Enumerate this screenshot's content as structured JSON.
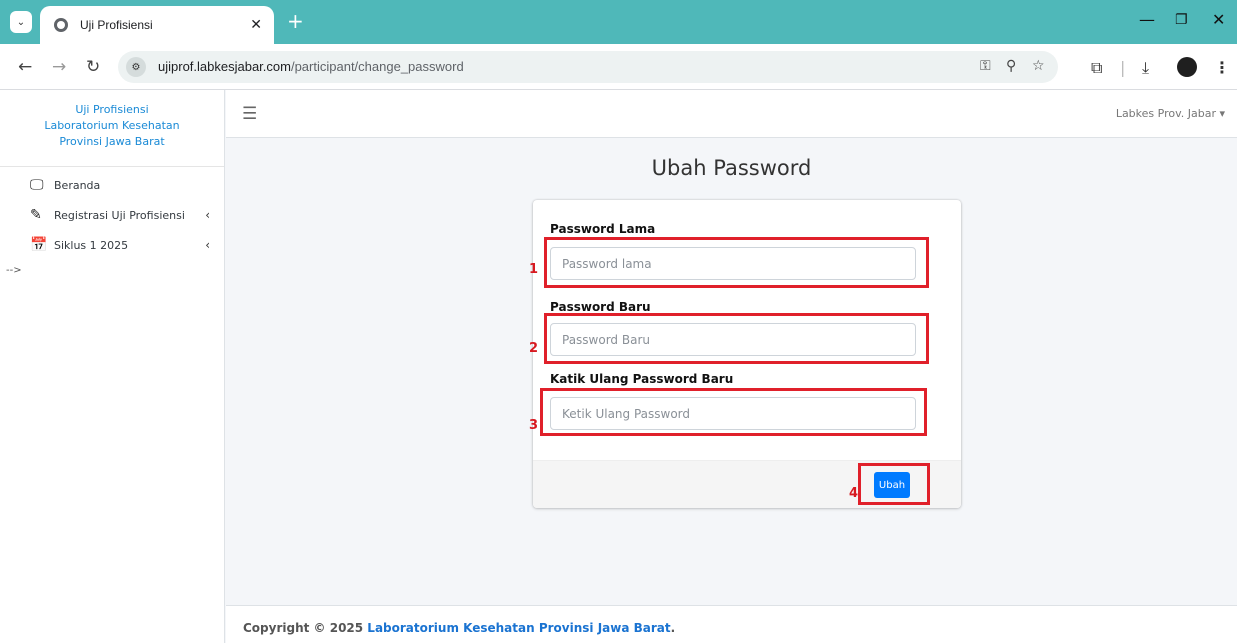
{
  "browser": {
    "tab_title": "Uji Profisiensi",
    "url_host": "ujiprof.labkesjabar.com",
    "url_path": "/participant/change_password"
  },
  "sidebar": {
    "brand_line1": "Uji Profisiensi",
    "brand_line2": "Laboratorium Kesehatan",
    "brand_line3": "Provinsi Jawa Barat",
    "items": [
      {
        "label": "Beranda",
        "icon": "monitor-icon"
      },
      {
        "label": "Registrasi Uji Profisiensi",
        "icon": "pencil-icon"
      },
      {
        "label": "Siklus 1 2025",
        "icon": "calendar-check-icon"
      }
    ],
    "stray_text": "-->"
  },
  "topnav": {
    "user": "Labkes Prov. Jabar"
  },
  "page": {
    "title": "Ubah Password"
  },
  "form": {
    "old_label": "Password Lama",
    "old_placeholder": "Password lama",
    "new_label": "Password Baru",
    "new_placeholder": "Password Baru",
    "confirm_label": "Katik Ulang Password Baru",
    "confirm_placeholder": "Ketik Ulang Password",
    "submit": "Ubah"
  },
  "annotations": {
    "color": "#e0202a",
    "labels": [
      "1",
      "2",
      "3",
      "4"
    ]
  },
  "footer": {
    "prefix": "Copyright © 2025 ",
    "org": "Laboratorium Kesehatan Provinsi Jawa Barat",
    "suffix": "."
  }
}
